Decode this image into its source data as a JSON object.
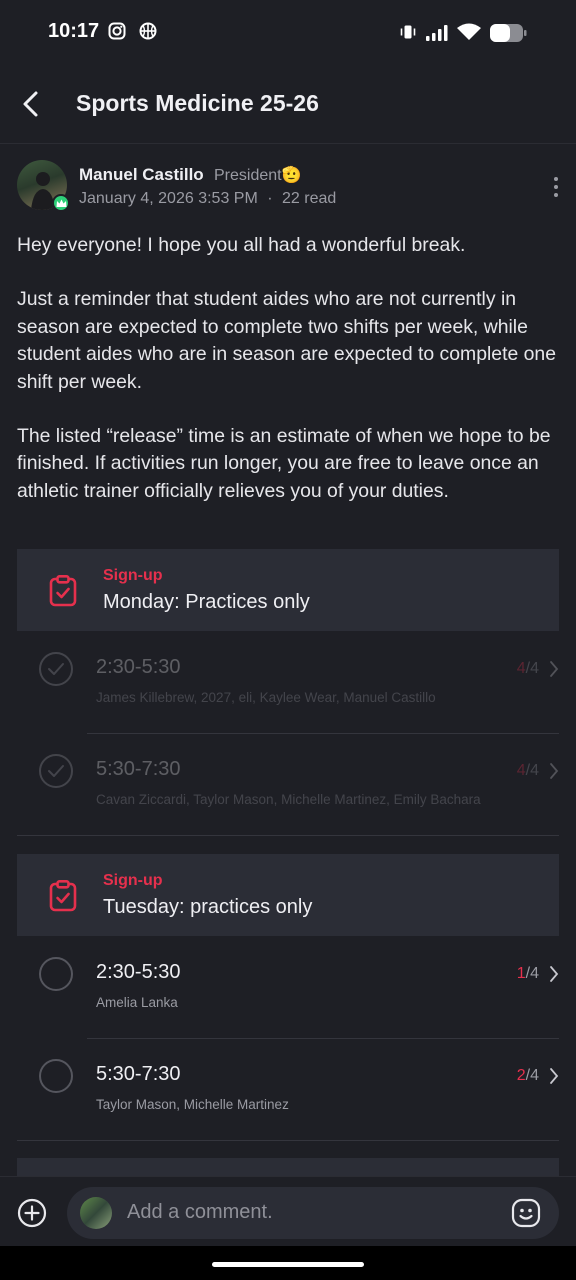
{
  "status_bar": {
    "time": "10:17"
  },
  "header": {
    "title": "Sports Medicine 25-26"
  },
  "post": {
    "author": "Manuel Castillo",
    "role": "President🫡",
    "date": "January 4, 2026 3:53 PM",
    "reads": "22 read",
    "paragraphs": [
      "Hey everyone! I hope you all had a wonderful break.",
      "Just a reminder that student aides who are not currently in season are expected to complete two shifts per week, while student aides who are in season are expected to complete one shift per week.",
      "The listed “release” time is an estimate of when we hope to be finished. If activities run longer, you are free to leave once an athletic trainer officially relieves you of your duties."
    ]
  },
  "signups": [
    {
      "label": "Sign-up",
      "title": "Monday: Practices only",
      "slots": [
        {
          "time": "2:30-5:30",
          "names": "James Killebrew, 2027, eli, Kaylee Wear, Manuel Castillo",
          "taken": "4",
          "total": "/4"
        },
        {
          "time": "5:30-7:30",
          "names": "Cavan Ziccardi, Taylor Mason, Michelle Martinez, Emily Bachara",
          "taken": "4",
          "total": "/4"
        }
      ]
    },
    {
      "label": "Sign-up",
      "title": "Tuesday: practices only",
      "slots": [
        {
          "time": "2:30-5:30",
          "names": "Amelia Lanka",
          "taken": "1",
          "total": "/4"
        },
        {
          "time": "5:30-7:30",
          "names": "Taylor Mason, Michelle Martinez",
          "taken": "2",
          "total": "/4"
        }
      ]
    }
  ],
  "composer": {
    "placeholder": "Add a comment."
  },
  "colors": {
    "accent": "#e6304d",
    "background": "#1e1f25",
    "card": "#2b2d36",
    "crown": "#2ecf78"
  }
}
